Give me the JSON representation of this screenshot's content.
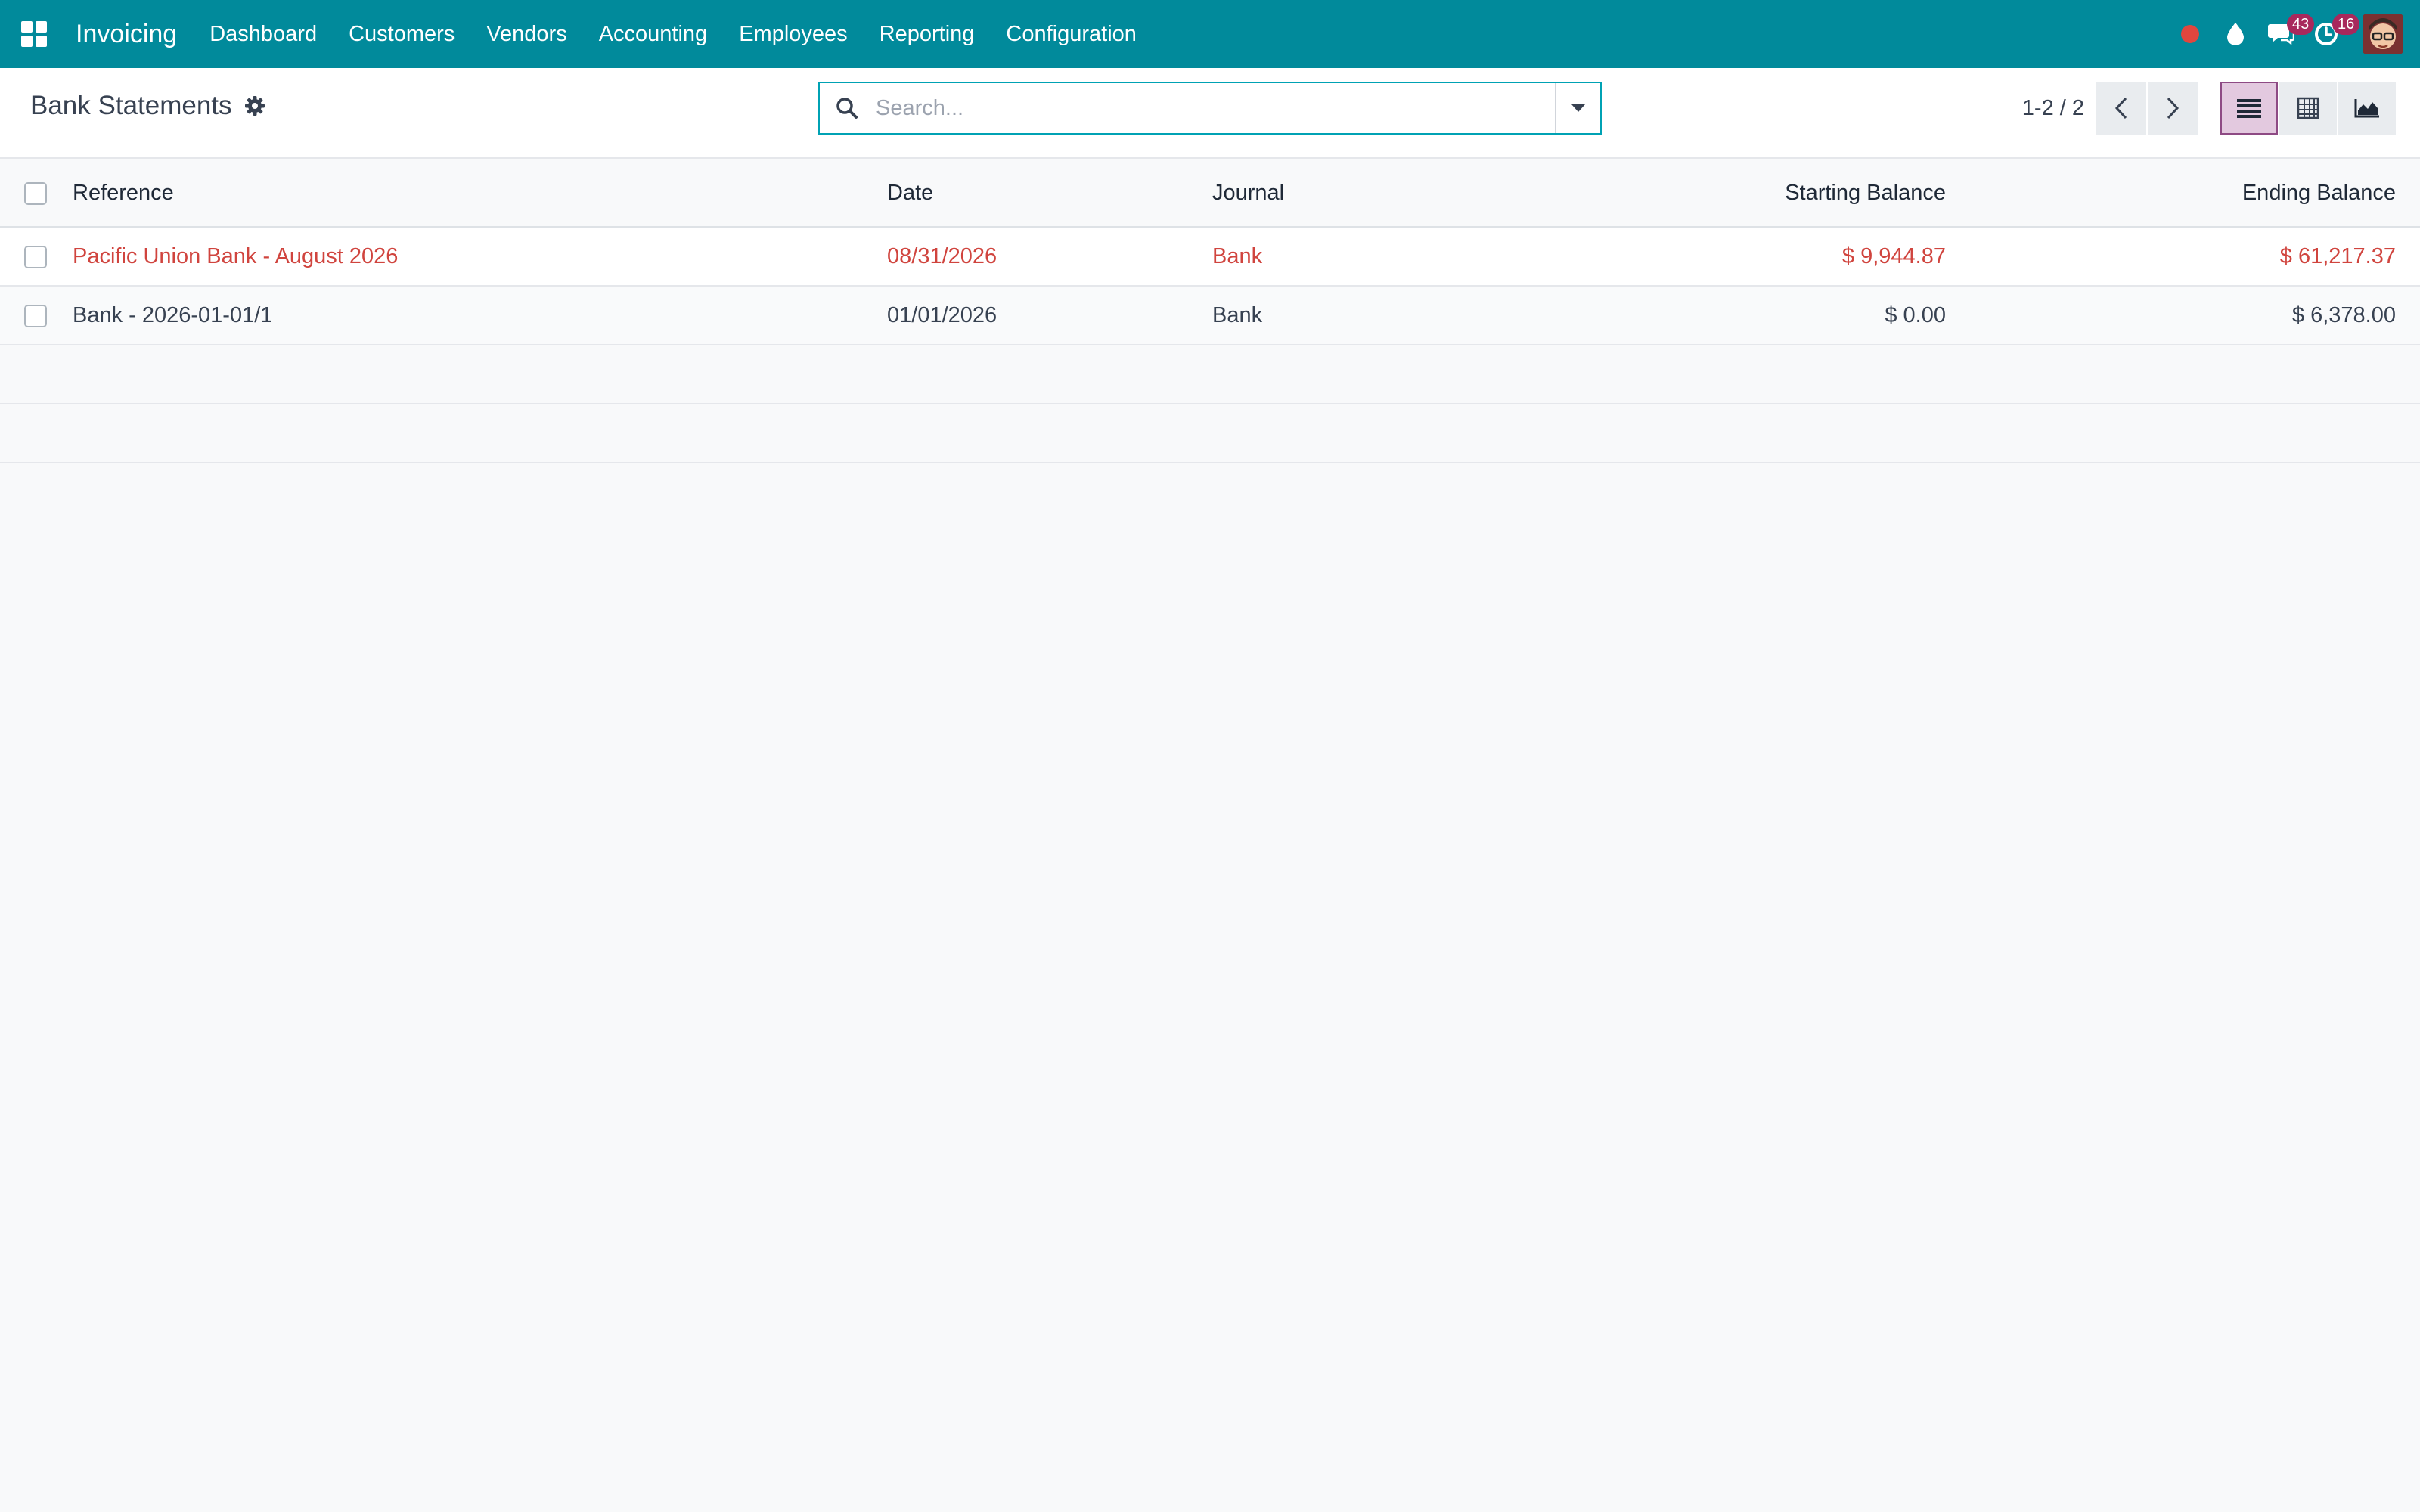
{
  "navbar": {
    "app_name": "Invoicing",
    "menu": [
      "Dashboard",
      "Customers",
      "Vendors",
      "Accounting",
      "Employees",
      "Reporting",
      "Configuration"
    ],
    "messages_count": "43",
    "activities_count": "16",
    "accent_color": "#018a9b"
  },
  "control_panel": {
    "title": "Bank Statements",
    "search_placeholder": "Search...",
    "pager": "1-2 / 2",
    "active_view": "list"
  },
  "table": {
    "columns": {
      "reference": "Reference",
      "date": "Date",
      "journal": "Journal",
      "starting_balance": "Starting Balance",
      "ending_balance": "Ending Balance"
    },
    "rows": [
      {
        "reference": "Pacific Union Bank - August 2026",
        "date": "08/31/2026",
        "journal": "Bank",
        "starting_balance": "$ 9,944.87",
        "ending_balance": "$ 61,217.37",
        "status_color": "#d0443e"
      },
      {
        "reference": "Bank - 2026-01-01/1",
        "date": "01/01/2026",
        "journal": "Bank",
        "starting_balance": "$ 0.00",
        "ending_balance": "$ 6,378.00"
      }
    ]
  }
}
